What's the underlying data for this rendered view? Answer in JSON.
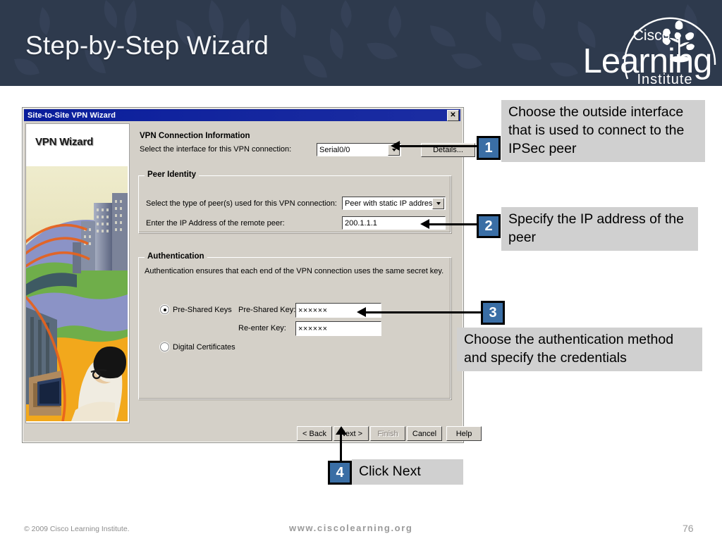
{
  "header": {
    "title": "Step-by-Step Wizard",
    "logo": {
      "line1": "Cisco",
      "line2": "Learning",
      "line3": "Institute",
      "icon": "tree-sapling-icon"
    },
    "background_color": "#2e3a4d"
  },
  "dialog": {
    "title": "Site-to-Site VPN Wizard",
    "close_label": "✕",
    "sidebar": {
      "title": "VPN Wizard",
      "illustration": "vpn-globe-network-illustration"
    },
    "connection_section": {
      "heading": "VPN Connection Information",
      "interface_label": "Select the interface for this VPN connection:",
      "interface_value": "Serial0/0",
      "details_button": "Details..."
    },
    "peer_section": {
      "heading": "Peer Identity",
      "peer_type_label": "Select the type of peer(s) used for this VPN connection:",
      "peer_type_value": "Peer with static IP address",
      "peer_ip_label": "Enter the IP Address of the remote peer:",
      "peer_ip_value": "200.1.1.1"
    },
    "authentication_section": {
      "heading": "Authentication",
      "description": "Authentication ensures that each end of the VPN connection uses the same secret key.",
      "option_preshared": "Pre-Shared Keys",
      "option_certificates": "Digital Certificates",
      "preshared_key_label": "Pre-Shared Key:",
      "preshared_key_value": "××××××",
      "reenter_key_label": "Re-enter Key:",
      "reenter_key_value": "××××××"
    },
    "buttons": {
      "back": "< Back",
      "next": "Next >",
      "finish": "Finish",
      "cancel": "Cancel",
      "help": "Help"
    }
  },
  "callouts": [
    {
      "number": "1",
      "text": "Choose the outside interface that is used to connect to the IPSec peer"
    },
    {
      "number": "2",
      "text": "Specify the IP address of the peer"
    },
    {
      "number": "3",
      "text": "Choose the authentication method and specify the credentials"
    },
    {
      "number": "4",
      "text": "Click Next"
    }
  ],
  "footer": {
    "copyright": "© 2009 Cisco Learning Institute.",
    "url": "www.ciscolearning.org",
    "page": "76"
  }
}
